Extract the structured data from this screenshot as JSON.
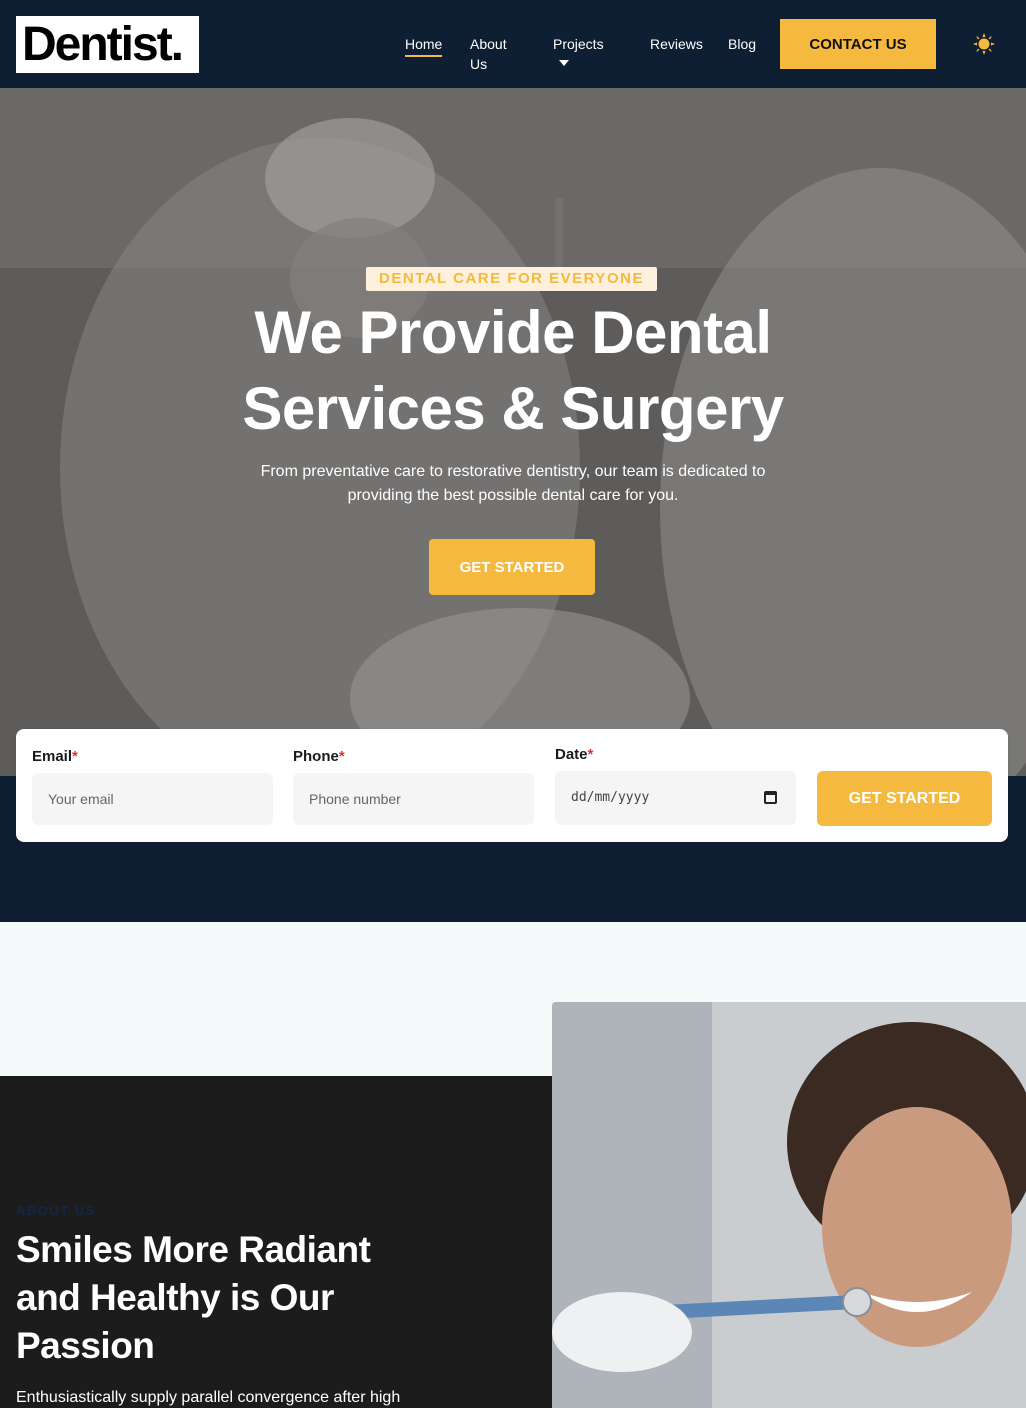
{
  "brand": {
    "logo_text": "Dentist."
  },
  "nav": {
    "items": [
      {
        "label": "Home"
      },
      {
        "label": "About Us"
      },
      {
        "label": "Projects"
      },
      {
        "label": "Reviews"
      },
      {
        "label": "Blog"
      }
    ],
    "contact_label": "CONTACT US",
    "theme_icon": "sun-icon"
  },
  "hero": {
    "badge": "DENTAL CARE FOR EVERYONE",
    "title_line1": "We Provide Dental",
    "title_line2": "Services & Surgery",
    "subtitle_line1": "From preventative care to restorative dentistry, our team is dedicated to",
    "subtitle_line2": "providing the best possible dental care for you.",
    "button_label": "GET STARTED"
  },
  "booking": {
    "email_label": "Email",
    "email_placeholder": "Your email",
    "phone_label": "Phone",
    "phone_placeholder": "Phone number",
    "date_label": "Date",
    "date_placeholder": "dd/mm/yyyy",
    "required_mark": "*",
    "button_label": "GET STARTED"
  },
  "about": {
    "kicker": "ABOUT US",
    "title_line1": "Smiles More Radiant",
    "title_line2": "and Healthy is Our",
    "title_line3": "Passion",
    "text": "Enthusiastically supply parallel convergence after high"
  },
  "colors": {
    "navy": "#0f1f33",
    "accent": "#f4b93e",
    "dark": "#1c1c1c",
    "light_bg": "#f4fbfb"
  }
}
